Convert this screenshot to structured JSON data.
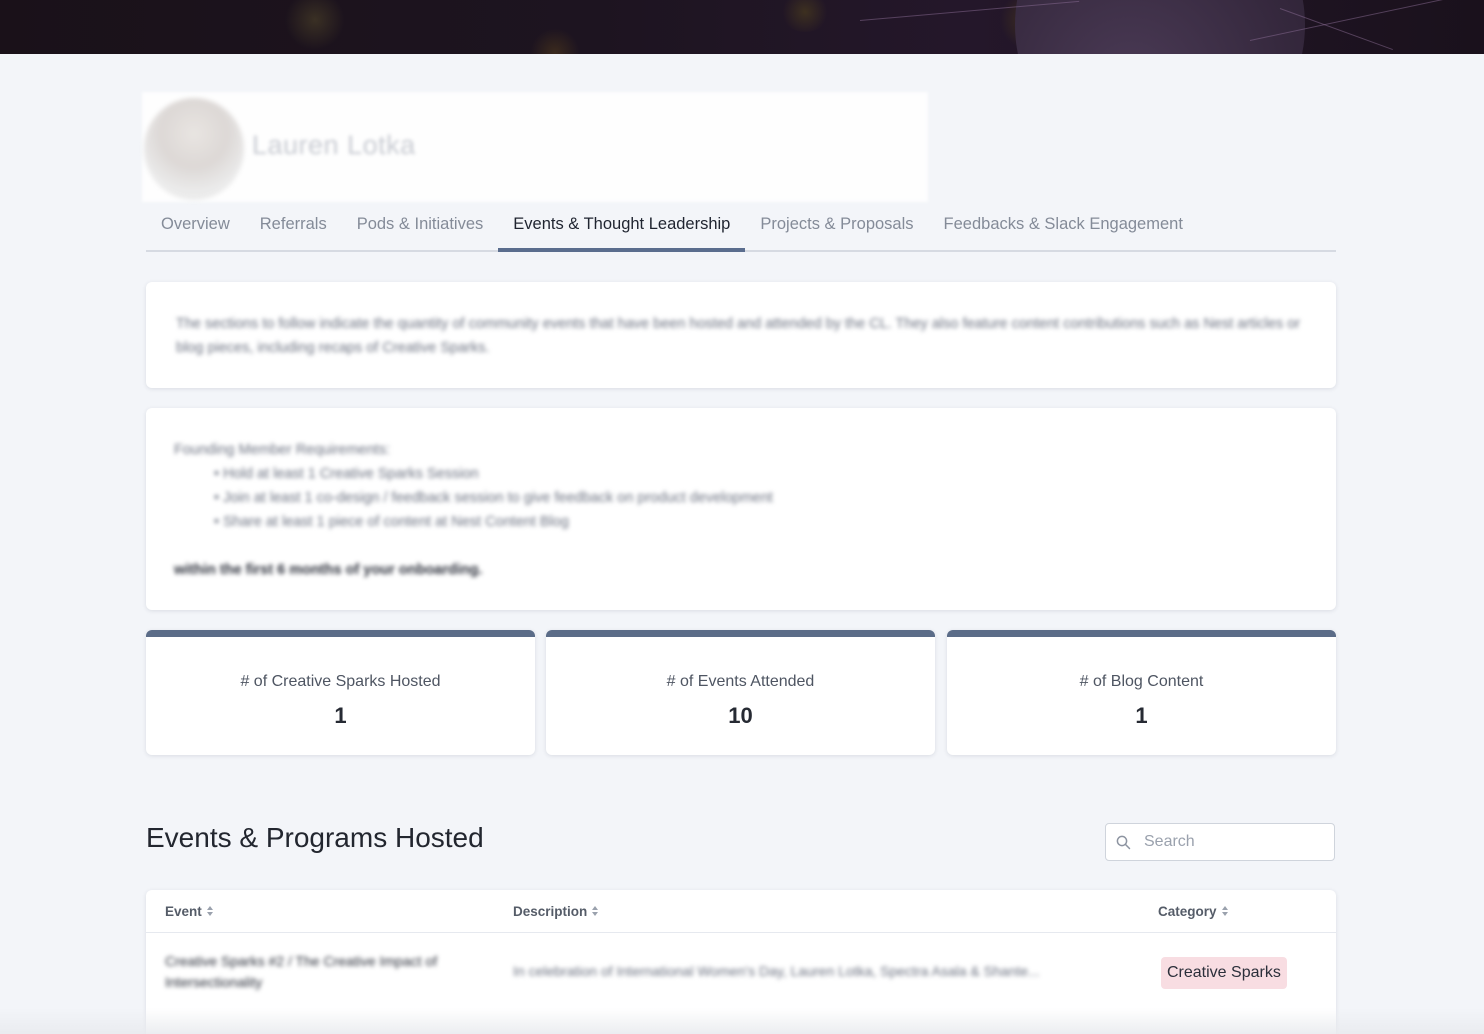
{
  "profile": {
    "name": "Lauren Lotka"
  },
  "tabs": [
    {
      "label": "Overview"
    },
    {
      "label": "Referrals"
    },
    {
      "label": "Pods & Initiatives"
    },
    {
      "label": "Events & Thought Leadership"
    },
    {
      "label": "Projects & Proposals"
    },
    {
      "label": "Feedbacks & Slack Engagement"
    }
  ],
  "intro": {
    "text": "The sections to follow indicate the quantity of community events that have been hosted and attended by the CL. They also feature content contributions such as Nest articles or blog pieces, including recaps of Creative Sparks."
  },
  "requirements": {
    "heading": "Founding Member Requirements:",
    "items": [
      "• Hold at least 1 Creative Sparks Session",
      "• Join at least 1 co-design / feedback session to give feedback on product development",
      "• Share at least 1 piece of content at Nest Content Blog"
    ],
    "footer": "within the first 6 months of your onboarding."
  },
  "stats": [
    {
      "label": "# of Creative Sparks Hosted",
      "value": "1"
    },
    {
      "label": "# of Events Attended",
      "value": "10"
    },
    {
      "label": "# of Blog Content",
      "value": "1"
    }
  ],
  "hosted": {
    "title": "Events & Programs Hosted",
    "search_placeholder": "Search",
    "columns": {
      "event": "Event",
      "description": "Description",
      "category": "Category"
    },
    "rows": [
      {
        "event": "Creative Sparks #2 / The Creative Impact of Intersectionality",
        "description": "In celebration of International Women's Day, Lauren Lotka, Spectra Asala & Shante...",
        "category": "Creative Sparks"
      }
    ]
  },
  "colors": {
    "accent": "#5b6c88",
    "badge_bg": "#f8dde2",
    "page_bg": "#f3f5f9"
  }
}
